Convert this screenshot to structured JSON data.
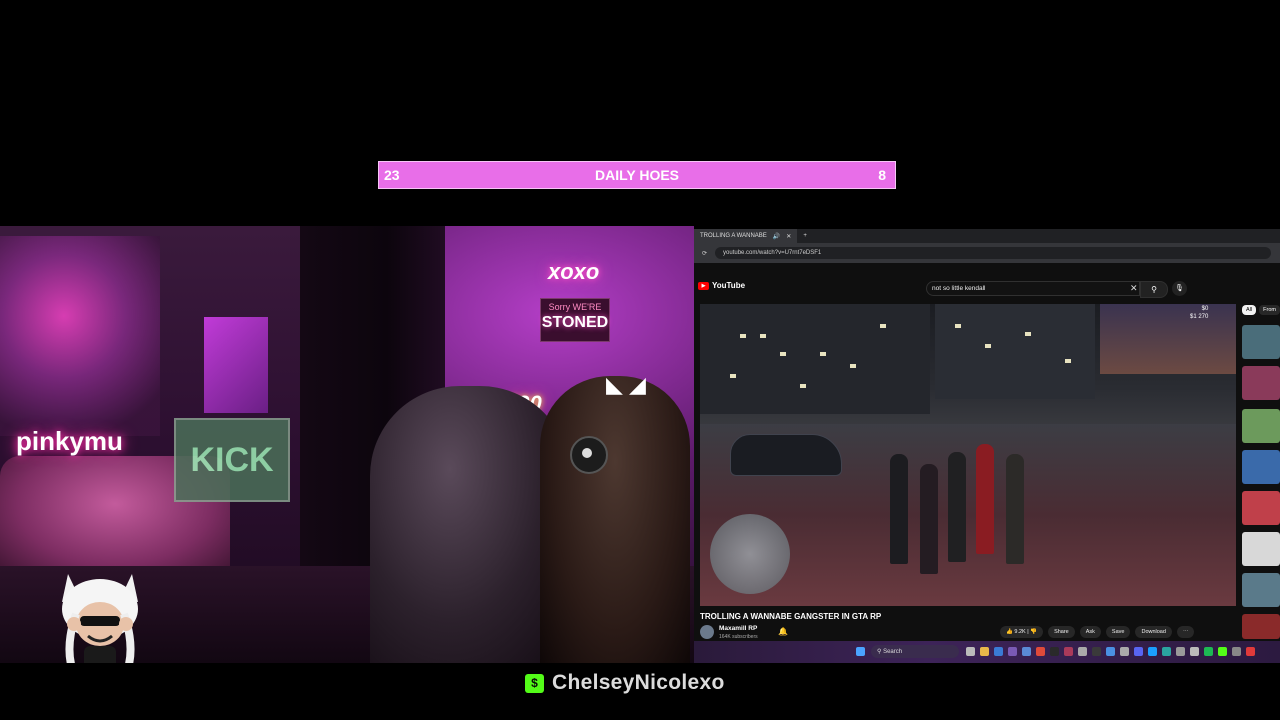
{
  "counter": {
    "left_count": "23",
    "title": "DAILY HOES",
    "right_count": "8"
  },
  "webcam": {
    "neon_left": "pinkymu",
    "kick_sign": "KICK",
    "neon_xoxo": "xoxo",
    "sign_small": "Sorry WE'RE",
    "sign_big": "STONED",
    "neon_420": "420"
  },
  "browser": {
    "tab_title": "TROLLING A WANNABE",
    "new_tab": "+",
    "url": "youtube.com/watch?v=U7rnt7eDSF1",
    "yt_logo": "YouTube",
    "search_value": "not so little kendall",
    "video_title": "TROLLING A WANNABE GANGSTER IN GTA RP",
    "channel_name": "Maxamill RP",
    "channel_subs": "164K subscribers",
    "hud_money": "$0",
    "hud_bank": "$1 270",
    "likes": "9.2K",
    "actions": [
      "Share",
      "Ask",
      "Save",
      "Download",
      "⋯"
    ],
    "chips": [
      "All",
      "From"
    ],
    "taskbar_search": "Search"
  },
  "watermark": {
    "platform_badge": "$",
    "handle": "ChelseyNicolexo"
  },
  "colors": {
    "counter_bg": "#e86ee8",
    "kick_green": "#53fc18",
    "yt_red": "#ff0000"
  }
}
